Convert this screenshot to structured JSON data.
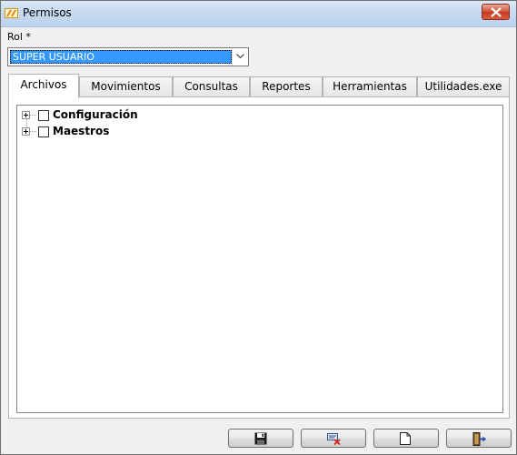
{
  "window": {
    "title": "Permisos"
  },
  "form": {
    "rol_label": "Rol *",
    "rol_value": "SUPER USUARIO"
  },
  "tabs": [
    {
      "label": "Archivos",
      "active": true
    },
    {
      "label": "Movimientos",
      "active": false
    },
    {
      "label": "Consultas",
      "active": false
    },
    {
      "label": "Reportes",
      "active": false
    },
    {
      "label": "Herramientas",
      "active": false
    },
    {
      "label": "Utilidades.exe",
      "active": false
    }
  ],
  "tree": {
    "nodes": [
      {
        "label": "Configuración",
        "checked": false,
        "expanded": false
      },
      {
        "label": "Maestros",
        "checked": false,
        "expanded": false
      }
    ]
  },
  "footer": {
    "buttons": [
      {
        "icon": "save-icon"
      },
      {
        "icon": "cancel-edit-icon"
      },
      {
        "icon": "new-document-icon"
      },
      {
        "icon": "exit-icon"
      }
    ]
  },
  "colors": {
    "selection": "#3399ff",
    "close_button": "#c94a34"
  }
}
